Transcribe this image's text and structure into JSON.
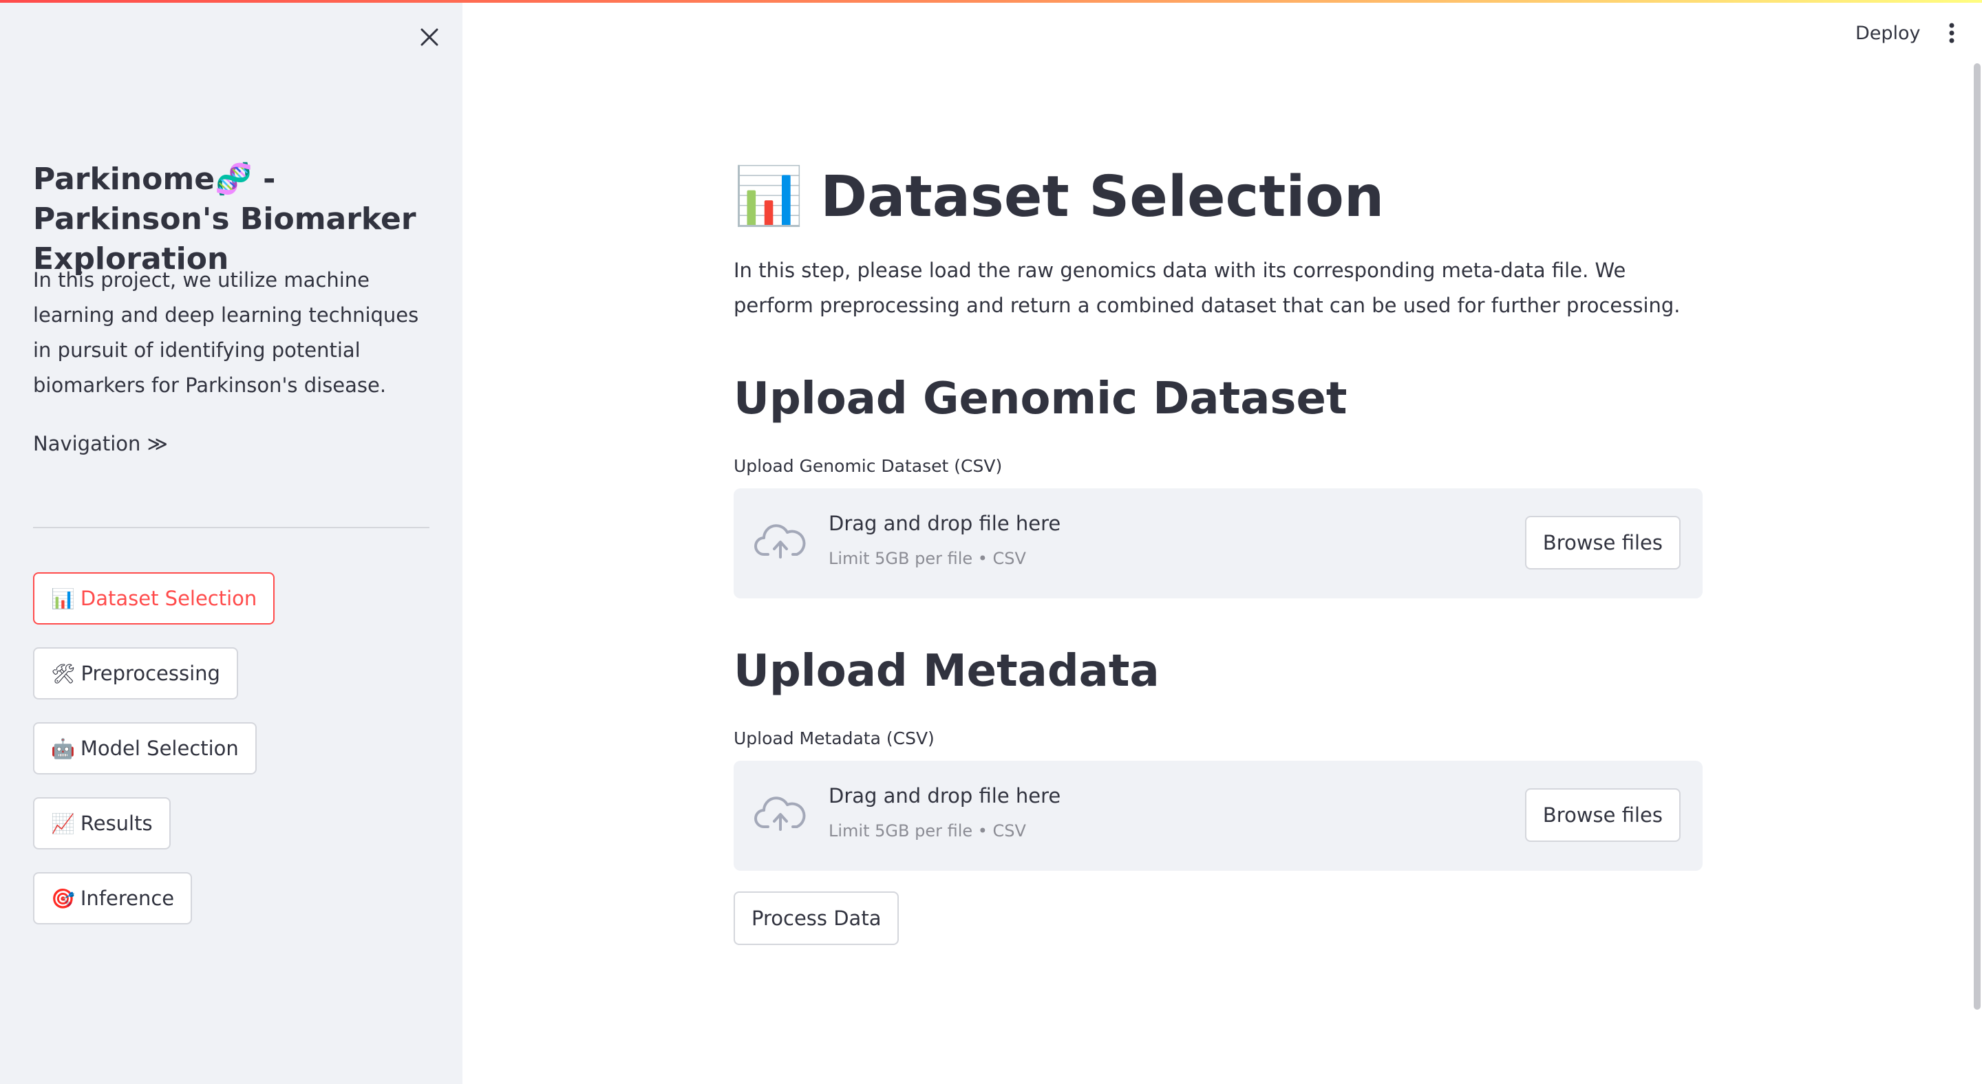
{
  "header": {
    "deploy_label": "Deploy",
    "menu_icon": "kebab-menu-icon"
  },
  "sidebar": {
    "close_icon": "close-icon",
    "title": "Parkinome🧬 - Parkinson's Biomarker Exploration",
    "description": "In this project, we utilize machine learning and deep learning techniques in pursuit of identifying potential biomarkers for Parkinson's disease.",
    "navigation_label": "Navigation ≫",
    "active_color": "#ff4b4b",
    "nav_items": [
      {
        "icon": "📊",
        "label": "Dataset Selection",
        "active": true
      },
      {
        "icon": "🛠",
        "label": "Preprocessing",
        "active": false
      },
      {
        "icon": "🤖",
        "label": "Model Selection",
        "active": false
      },
      {
        "icon": "📈",
        "label": "Results",
        "active": false
      },
      {
        "icon": "🎯",
        "label": "Inference",
        "active": false
      }
    ]
  },
  "main": {
    "title_icon": "📊",
    "title": "Dataset Selection",
    "intro": "In this step, please load the raw genomics data with its corresponding meta-data file. We perform preprocessing and return a combined dataset that can be used for further processing.",
    "uploads": [
      {
        "heading": "Upload Genomic Dataset",
        "label": "Upload Genomic Dataset (CSV)",
        "drop_text": "Drag and drop file here",
        "limit_text": "Limit 5GB per file • CSV",
        "browse_label": "Browse files",
        "icon": "cloud-upload-icon"
      },
      {
        "heading": "Upload Metadata",
        "label": "Upload Metadata (CSV)",
        "drop_text": "Drag and drop file here",
        "limit_text": "Limit 5GB per file • CSV",
        "browse_label": "Browse files",
        "icon": "cloud-upload-icon"
      }
    ],
    "process_label": "Process Data"
  }
}
